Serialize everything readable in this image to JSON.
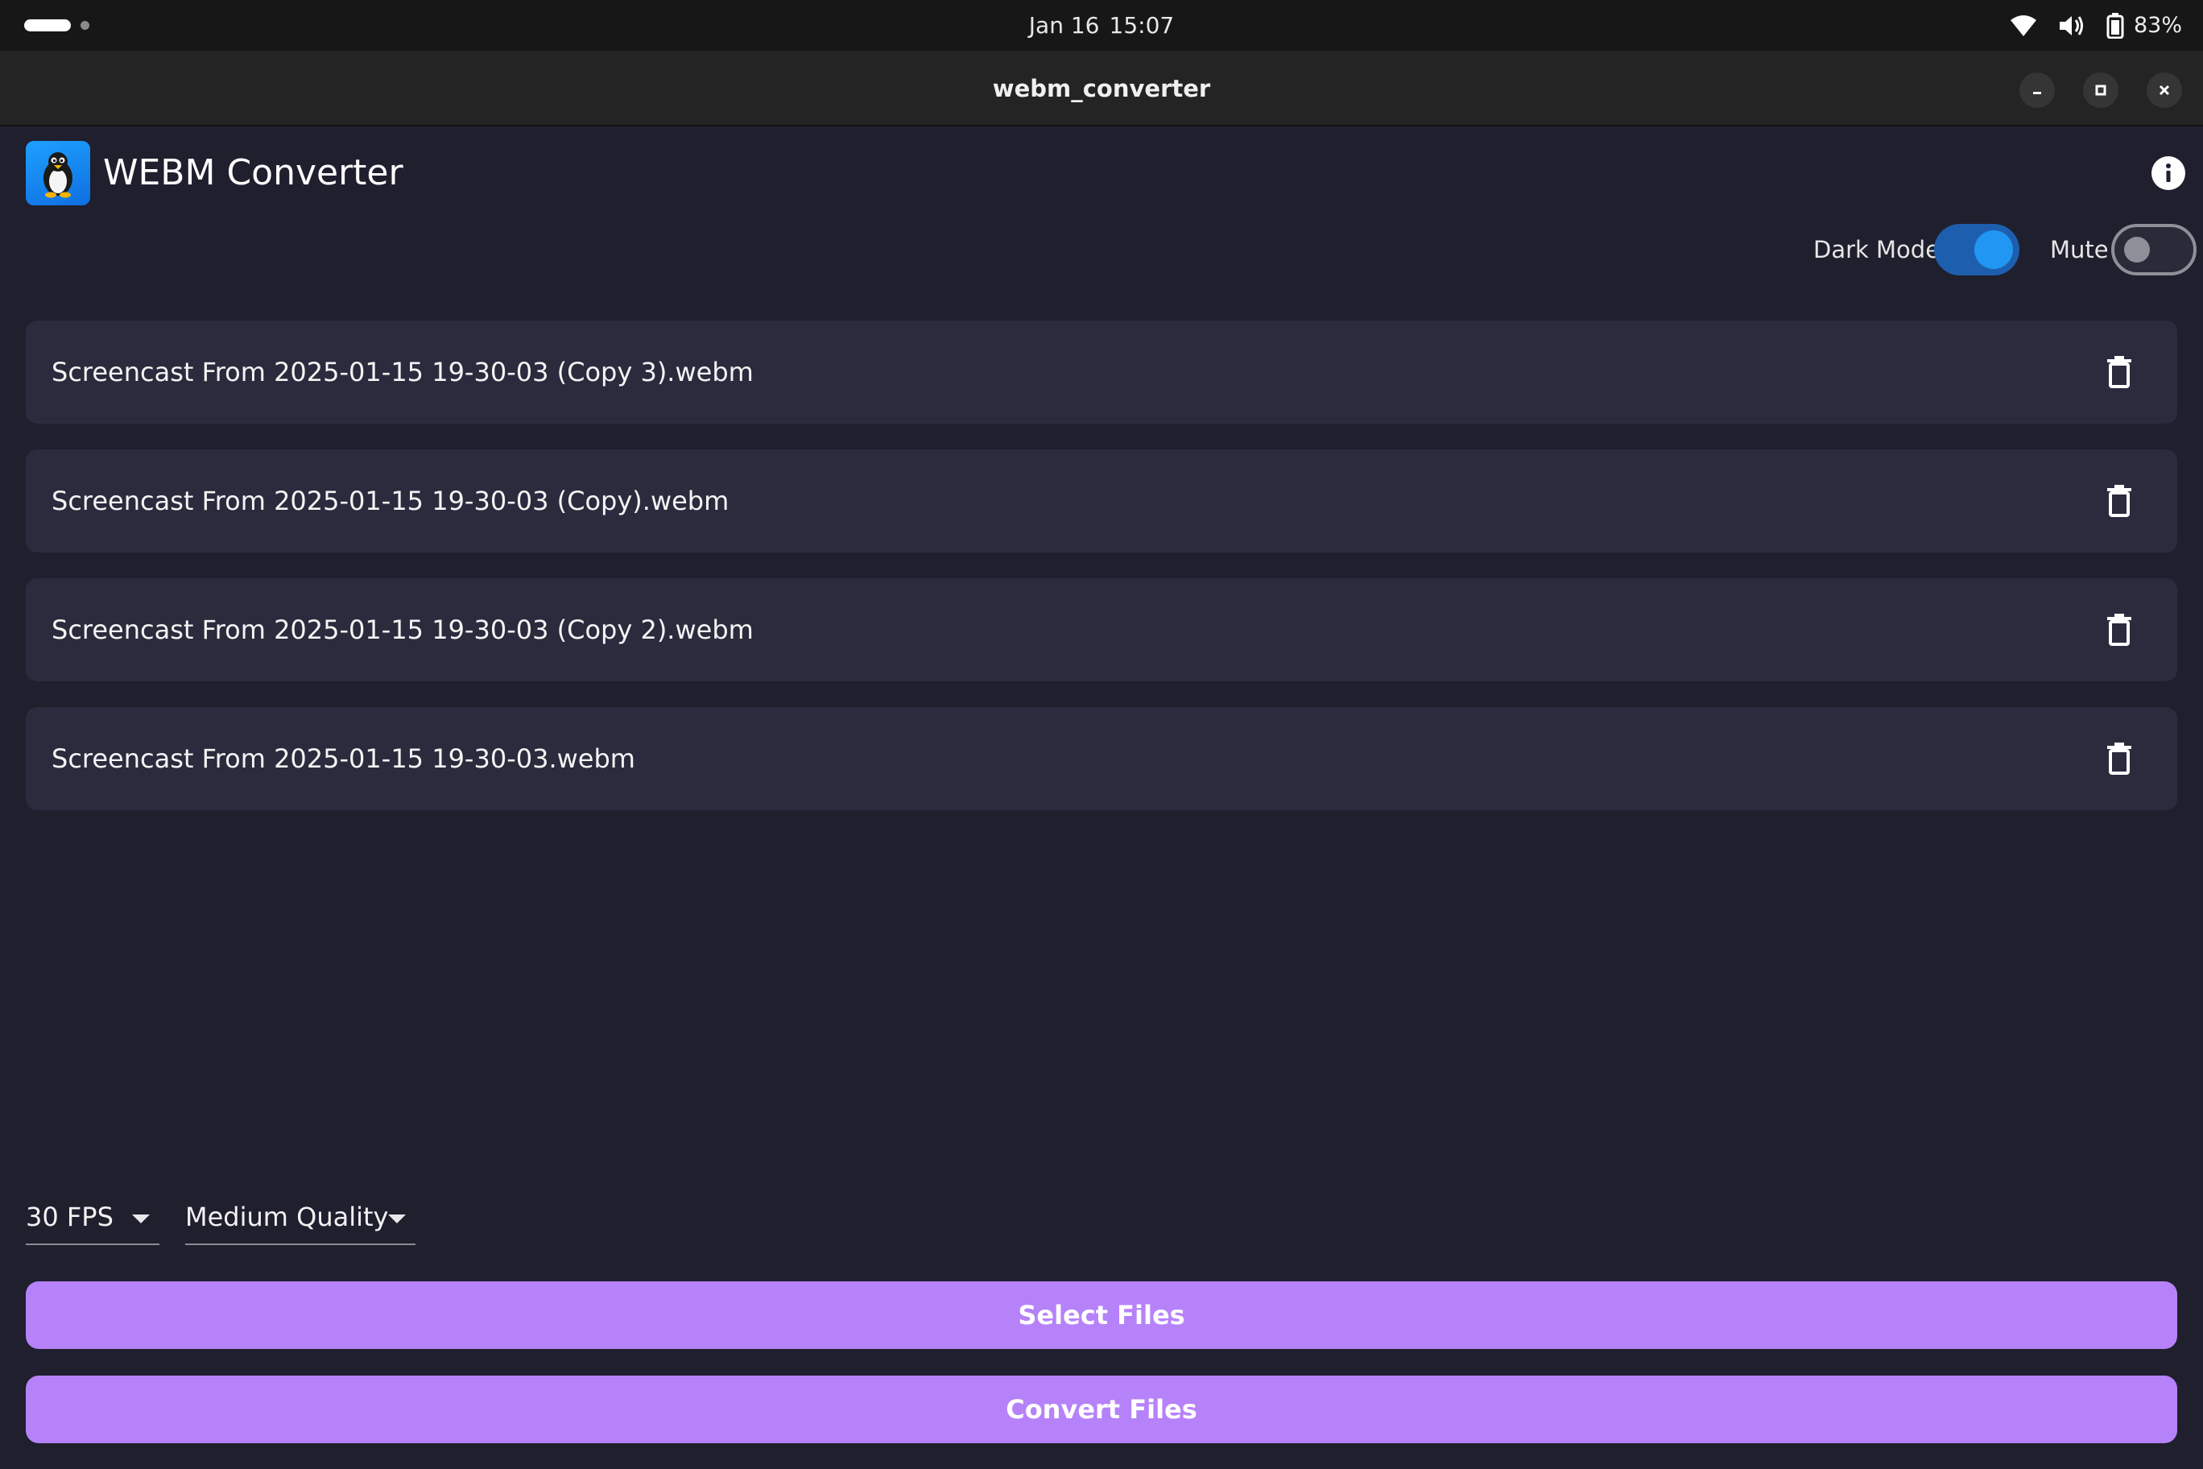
{
  "system_bar": {
    "date": "Jan 16",
    "time": "15:07",
    "battery_percent": "83%",
    "icons": [
      "wifi-icon",
      "volume-icon",
      "battery-icon"
    ]
  },
  "window": {
    "title": "webm_converter",
    "controls": [
      "minimize",
      "maximize",
      "close"
    ]
  },
  "app": {
    "title": "WEBM Converter",
    "icon": "penguin-app-icon"
  },
  "toggles": {
    "dark_mode": {
      "label": "Dark Mode",
      "on": true
    },
    "mute": {
      "label": "Mute",
      "on": false
    }
  },
  "files": [
    {
      "name": "Screencast From 2025-01-15 19-30-03 (Copy 3).webm"
    },
    {
      "name": "Screencast From 2025-01-15 19-30-03 (Copy).webm"
    },
    {
      "name": "Screencast From 2025-01-15 19-30-03 (Copy 2).webm"
    },
    {
      "name": "Screencast From 2025-01-15 19-30-03.webm"
    }
  ],
  "settings": {
    "fps": {
      "selected": "30 FPS"
    },
    "quality": {
      "selected": "Medium Quality"
    }
  },
  "buttons": {
    "select_files": "Select Files",
    "convert_files": "Convert Files"
  },
  "colors": {
    "background": "#1f1f2e",
    "card": "#2b2b3e",
    "accent_button": "#b682f9",
    "toggle_on": "#2196f3"
  }
}
